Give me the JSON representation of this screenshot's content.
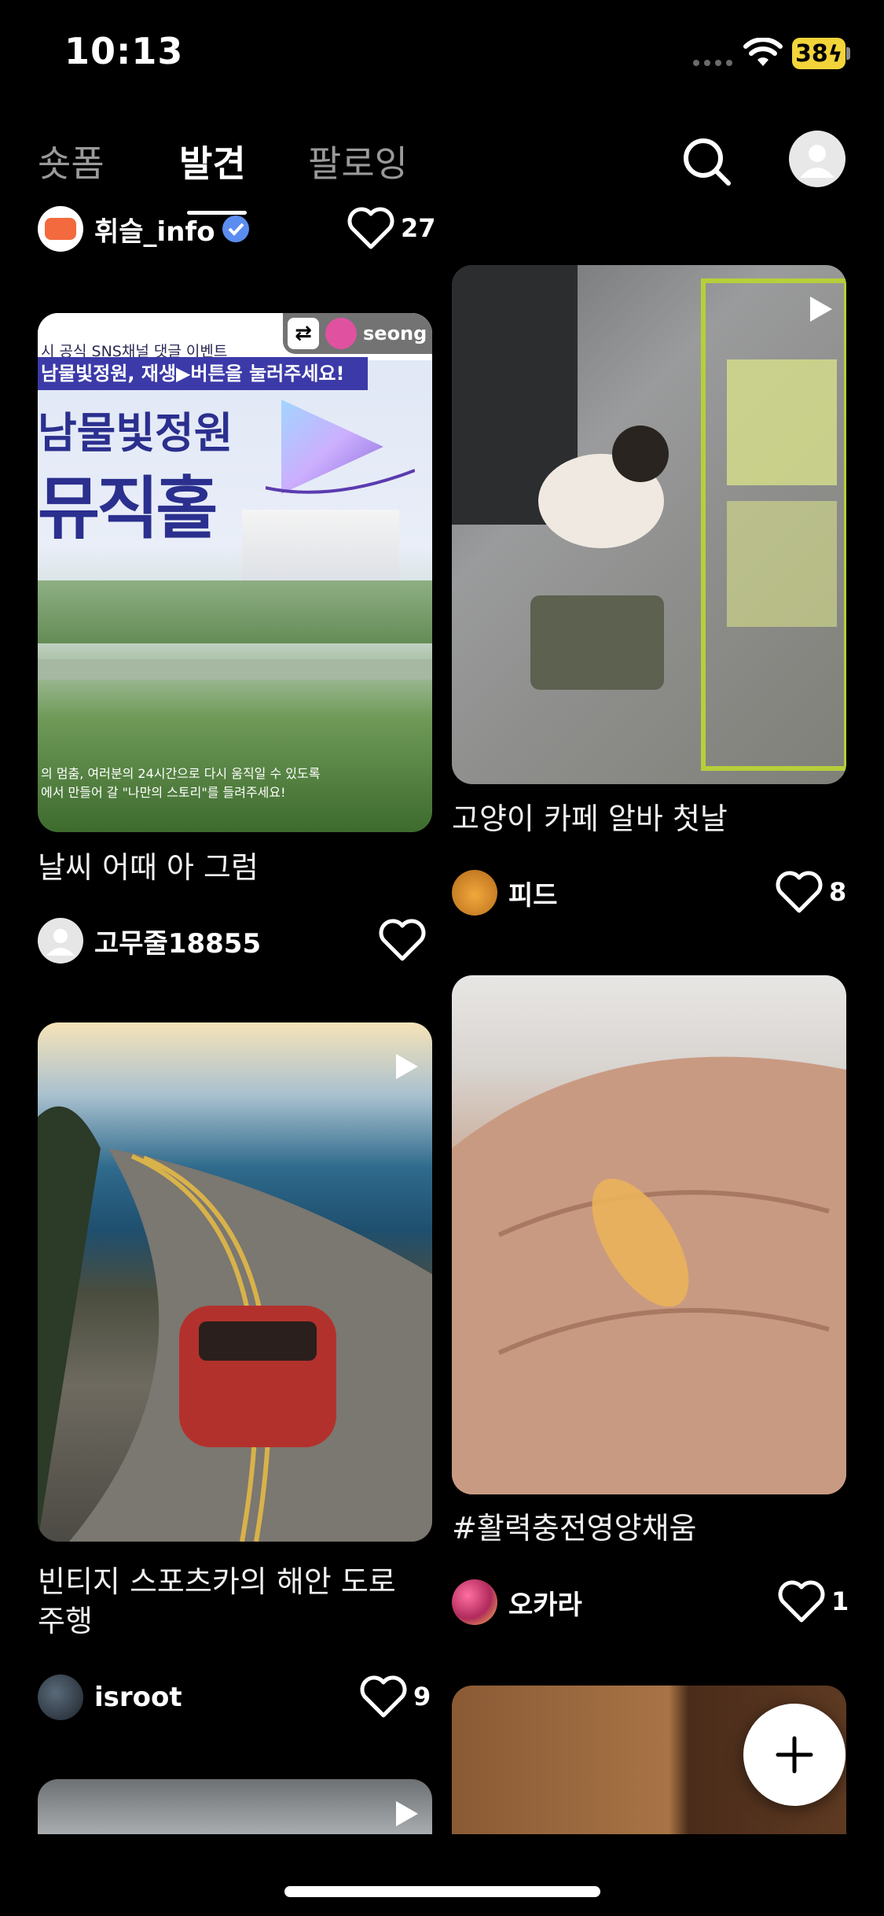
{
  "status_bar": {
    "time": "10:13",
    "battery": "38"
  },
  "header": {
    "tabs": [
      {
        "label": "숏폼"
      },
      {
        "label": "발견"
      },
      {
        "label": "팔로잉"
      }
    ]
  },
  "feed": {
    "top_partial": {
      "author": "휘슬_info",
      "likes": "27"
    },
    "left": [
      {
        "banner_top": "시 공식 SNS채널 댓글 이벤트",
        "banner_sub": "남물빛정원, 재생▶버튼을 눌러주세요!",
        "banner_title1": "남물빛정원",
        "banner_title2": "뮤직홀",
        "banner_bottom1": "의 멈춤, 여러분의 24시간으로 다시 움직일 수 있도록",
        "banner_bottom2": "에서 만들어 갈 \"나만의 스토리\"를 들려주세요!",
        "repost_user": "seong",
        "caption": "날씨 어때 아 그럼",
        "author": "고무줄18855",
        "likes": ""
      },
      {
        "caption": "빈티지 스포츠카의 해안 도로 주행",
        "author": "isroot",
        "likes": "9"
      }
    ],
    "right": [
      {
        "caption": "고양이 카페 알바 첫날",
        "author": "피드",
        "likes": "8"
      },
      {
        "caption": "#활력충전영양채움",
        "author": "오카라",
        "likes": "1"
      }
    ]
  },
  "fab": {
    "label": "+"
  }
}
